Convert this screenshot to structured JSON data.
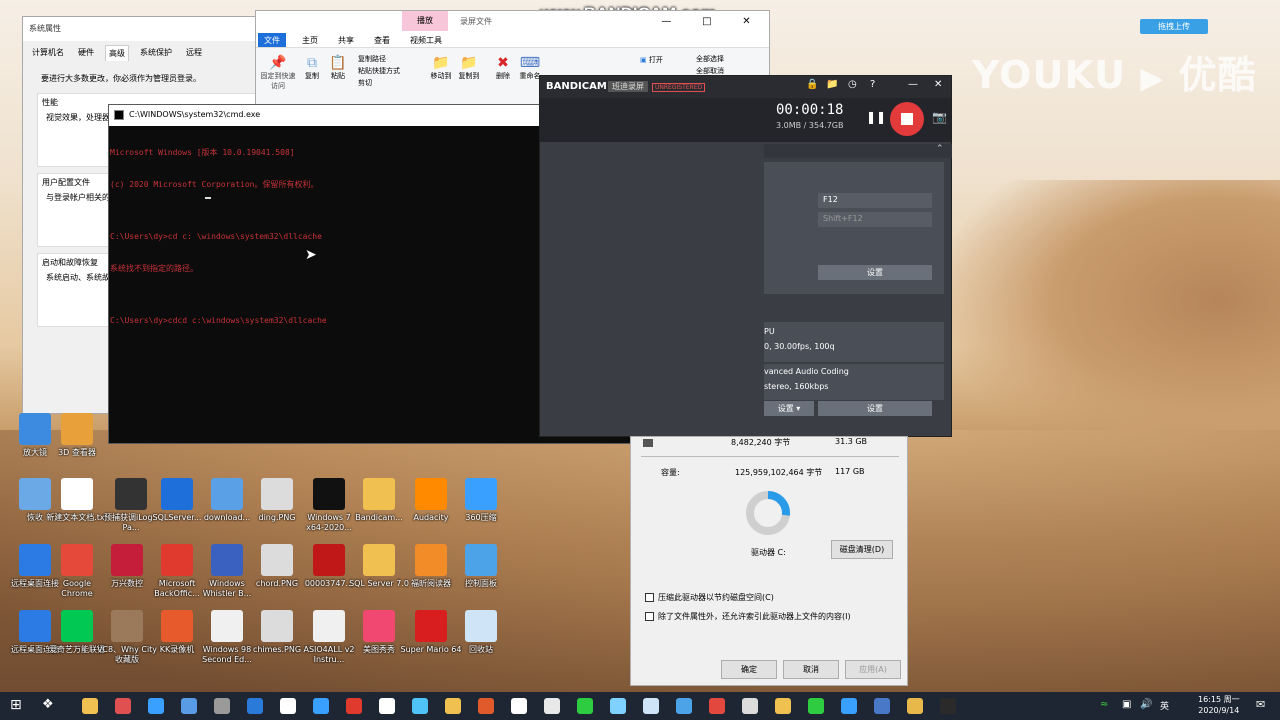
{
  "watermark": "www.BANDICAM.com",
  "youku": {
    "brand": "YOUKU",
    "brand_cn": "优酷",
    "upload_label": "拖拽上传"
  },
  "sysprops": {
    "title": "系统属性",
    "tabs": [
      "计算机名",
      "硬件",
      "高级",
      "系统保护",
      "远程"
    ],
    "admin_note": "要进行大多数更改，你必须作为管理员登录。",
    "perf_title": "性能",
    "perf_desc": "视觉效果，处理器",
    "profile_title": "用户配置文件",
    "profile_desc": "与登录帐户相关的",
    "startup_title": "启动和故障恢复",
    "startup_desc": "系统启动、系统故"
  },
  "explorer": {
    "context_tab": "播放",
    "window_title": "录屏文件",
    "tabs": [
      "文件",
      "主页",
      "共享",
      "查看",
      "视频工具"
    ],
    "buttons": {
      "pin": "固定到快速访问",
      "copy": "复制",
      "paste": "粘贴",
      "copy_path": "复制路径",
      "paste_shortcut": "粘贴快捷方式",
      "cut": "剪切",
      "move_to": "移动到",
      "copy_to": "复制到",
      "delete": "删除",
      "rename": "重命名",
      "open": "打开",
      "select_all": "全部选择",
      "select_none": "全部取消"
    }
  },
  "cmd": {
    "title": "C:\\WINDOWS\\system32\\cmd.exe",
    "lines": [
      "Microsoft Windows [版本 10.0.19041.508]",
      "(c) 2020 Microsoft Corporation。保留所有权利。",
      "",
      "C:\\Users\\dy>cd c: \\windows\\system32\\dllcache",
      "系统找不到指定的路径。",
      "",
      "C:\\Users\\dy>cdcd c:\\windows\\system32\\dllcache"
    ]
  },
  "bandicam": {
    "logo": "BANDICAM",
    "mode": "班迪录屏",
    "unregistered": "UNREGISTERED",
    "timer": "00:00:18",
    "size": "3.0MB / 354.7GB",
    "hotkey1": "F12",
    "hotkey2": "Shift+F12",
    "settings": "设置",
    "video_label": "PU",
    "video_detail": "0, 30.00fps, 100q",
    "audio_label": "vanced Audio Coding",
    "audio_detail": "stereo, 160kbps",
    "preset": "设置",
    "settings2": "设置"
  },
  "drive": {
    "used_bytes": "8,482,240 字节",
    "used_gb": "31.3 GB",
    "capacity_label": "容量:",
    "capacity_bytes": "125,959,102,464 字节",
    "capacity_gb": "117 GB",
    "drive_label": "驱动器 C:",
    "cleanup": "磁盘清理(D)",
    "compress": "压缩此驱动器以节约磁盘空间(C)",
    "index": "除了文件属性外，还允许索引此驱动器上文件的内容(I)",
    "ok": "确定",
    "cancel": "取消",
    "apply": "应用(A)",
    "used_fraction": 0.27
  },
  "desktop_icons": [
    {
      "label": "放大镜",
      "color": "#3c8be0"
    },
    {
      "label": "3D 查看器",
      "color": "#e8a03a"
    },
    {
      "label": "恢收",
      "color": "#6aa9e6"
    },
    {
      "label": "新建文本文档.txt",
      "color": "#ffffff"
    },
    {
      "label": "预捕获调iLog - Pa...",
      "color": "#333333"
    },
    {
      "label": "SQLServer...",
      "color": "#1e6fd9"
    },
    {
      "label": "download...",
      "color": "#5aa0e6"
    },
    {
      "label": "ding.PNG",
      "color": "#dcdcdc"
    },
    {
      "label": "Windows 7 x64-2020...",
      "color": "#111111"
    },
    {
      "label": "Bandicam...",
      "color": "#f0c050"
    },
    {
      "label": "Audacity",
      "color": "#ff8a00"
    },
    {
      "label": "360压缩",
      "color": "#3aa0ff"
    },
    {
      "label": "远程桌面连接",
      "color": "#2c7be5"
    },
    {
      "label": "Google Chrome",
      "color": "#e5493a"
    },
    {
      "label": "万兴数控",
      "color": "#c41e3a"
    },
    {
      "label": "Microsoft BackOffic...",
      "color": "#e03a2f"
    },
    {
      "label": "Windows Whistler B...",
      "color": "#3a60c0"
    },
    {
      "label": "chord.PNG",
      "color": "#dcdcdc"
    },
    {
      "label": "00003747...",
      "color": "#c01818"
    },
    {
      "label": "SQL Server 7.0",
      "color": "#f0c050"
    },
    {
      "label": "福昕阅读器",
      "color": "#f28c28"
    },
    {
      "label": "控制面板",
      "color": "#4da3e8"
    },
    {
      "label": "远程桌面连接",
      "color": "#2c7be5"
    },
    {
      "label": "爱奇艺万能联播",
      "color": "#00c853"
    },
    {
      "label": "VC8、Why City 收藏版",
      "color": "#9a7a5a"
    },
    {
      "label": "KK录像机",
      "color": "#e65a2c"
    },
    {
      "label": "Windows 98 Second Ed...",
      "color": "#f0f0f0"
    },
    {
      "label": "chimes.PNG",
      "color": "#dcdcdc"
    },
    {
      "label": "ASIO4ALL v2 Instru...",
      "color": "#f0f0f0"
    },
    {
      "label": "美图秀秀",
      "color": "#f04870"
    },
    {
      "label": "Super Mario 64",
      "color": "#d81e1e"
    },
    {
      "label": "回收站",
      "color": "#cfe4f7"
    }
  ],
  "taskbar": {
    "time": "16:15 周一",
    "date": "2020/9/14"
  }
}
